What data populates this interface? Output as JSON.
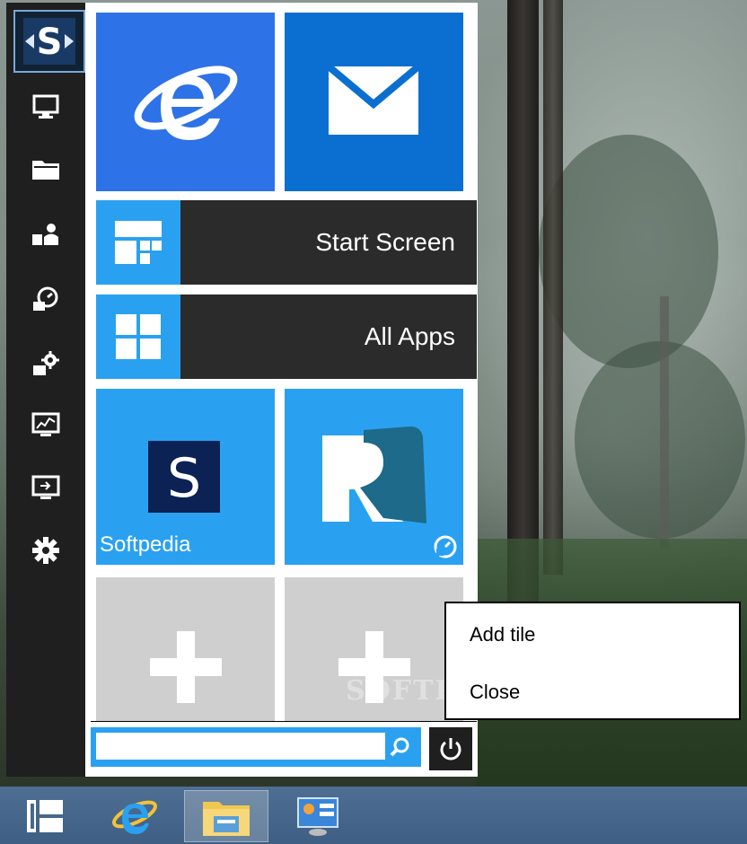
{
  "menu": {
    "wide_tiles": [
      {
        "label": "Start Screen",
        "icon": "start-screen-icon"
      },
      {
        "label": "All Apps",
        "icon": "windows-logo-icon"
      }
    ],
    "tiles": [
      {
        "icon": "internet-explorer-icon"
      },
      {
        "icon": "mail-icon"
      },
      {
        "label": "Softpedia",
        "icon": "softpedia-logo-icon"
      },
      {
        "icon": "app-r-icon"
      }
    ],
    "sidebar_icons": [
      "app-logo-icon",
      "computer-icon",
      "folder-icon",
      "user-icon",
      "restore-icon",
      "control-panel-icon",
      "performance-icon",
      "remote-desktop-icon",
      "settings-icon"
    ],
    "search": {
      "value": ""
    }
  },
  "context_menu": {
    "items": [
      "Add tile",
      "Close"
    ]
  },
  "watermark": "SOFTPEDIA",
  "colors": {
    "accent": "#2aa1f0",
    "dark": "#2b2b2b",
    "ie_tile": "#2e72e8",
    "mail_tile": "#0a6fd0"
  }
}
